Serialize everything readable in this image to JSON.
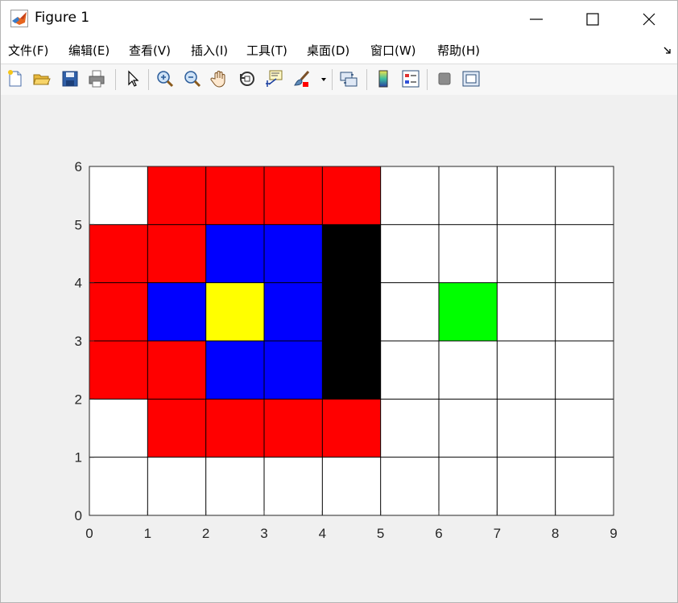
{
  "window": {
    "title": "Figure 1"
  },
  "menu": {
    "items": [
      {
        "id": "file",
        "label": "文件(F)"
      },
      {
        "id": "edit",
        "label": "编辑(E)"
      },
      {
        "id": "view",
        "label": "查看(V)"
      },
      {
        "id": "insert",
        "label": "插入(I)"
      },
      {
        "id": "tools",
        "label": "工具(T)"
      },
      {
        "id": "desktop",
        "label": "桌面(D)"
      },
      {
        "id": "window",
        "label": "窗口(W)"
      },
      {
        "id": "help",
        "label": "帮助(H)"
      }
    ]
  },
  "toolbar": {
    "icons": [
      "new-figure-icon",
      "open-file-icon",
      "save-icon",
      "print-icon",
      "pointer-icon",
      "zoom-in-icon",
      "zoom-out-icon",
      "pan-hand-icon",
      "rotate-3d-icon",
      "data-cursor-icon",
      "brush-icon",
      "link-plot-icon",
      "colorbar-icon",
      "legend-icon",
      "hide-plot-tools-icon",
      "show-plot-tools-icon"
    ]
  },
  "colors": {
    "red": "#ff0000",
    "blue": "#0000ff",
    "yellow": "#ffff00",
    "black": "#000000",
    "green": "#00ff00",
    "white": "#ffffff"
  },
  "chart_data": {
    "type": "heatmap",
    "title": "",
    "xlabel": "",
    "ylabel": "",
    "xlim": [
      0,
      9
    ],
    "ylim": [
      0,
      6
    ],
    "xticks": [
      "0",
      "1",
      "2",
      "3",
      "4",
      "5",
      "6",
      "7",
      "8",
      "9"
    ],
    "yticks": [
      "0",
      "1",
      "2",
      "3",
      "4",
      "5",
      "6"
    ],
    "grid": true,
    "cells": [
      [
        "white",
        "red",
        "red",
        "red",
        "red",
        "white",
        "white",
        "white",
        "white"
      ],
      [
        "red",
        "red",
        "blue",
        "blue",
        "black",
        "white",
        "white",
        "white",
        "white"
      ],
      [
        "red",
        "blue",
        "yellow",
        "blue",
        "black",
        "white",
        "green",
        "white",
        "white"
      ],
      [
        "red",
        "red",
        "blue",
        "blue",
        "black",
        "white",
        "white",
        "white",
        "white"
      ],
      [
        "white",
        "red",
        "red",
        "red",
        "red",
        "white",
        "white",
        "white",
        "white"
      ],
      [
        "white",
        "white",
        "white",
        "white",
        "white",
        "white",
        "white",
        "white",
        "white"
      ]
    ]
  }
}
